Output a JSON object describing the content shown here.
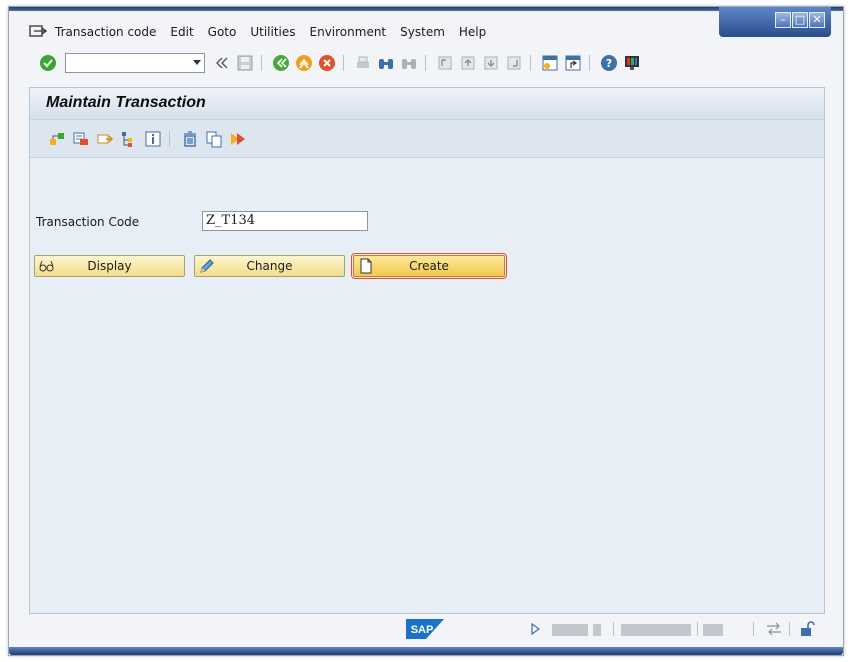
{
  "menubar": {
    "items": [
      "Transaction code",
      "Edit",
      "Goto",
      "Utilities",
      "Environment",
      "System",
      "Help"
    ]
  },
  "toolbar": {
    "command_field_value": ""
  },
  "screen": {
    "title": "Maintain Transaction"
  },
  "form": {
    "transaction_code_label": "Transaction Code",
    "transaction_code_value": "Z_T134"
  },
  "buttons": {
    "display": "Display",
    "change": "Change",
    "create": "Create"
  },
  "status": {
    "logo_text": "SAP"
  },
  "colors": {
    "title_bar": "#d6e1ec",
    "button_bg": "#f3de8a",
    "focus_outline": "#e05030",
    "window_frame": "#2a4d8c"
  }
}
